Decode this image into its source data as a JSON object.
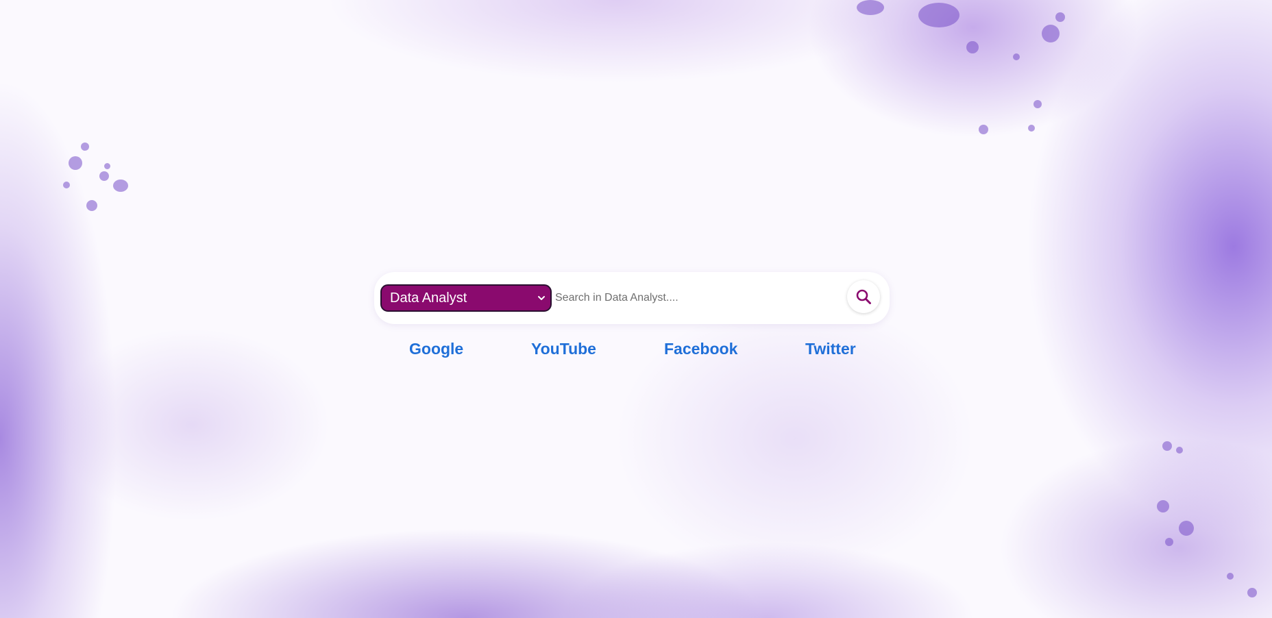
{
  "search": {
    "category_selected": "Data Analyst",
    "placeholder": "Search in Data Analyst....",
    "value": "",
    "button_icon": "search-icon",
    "accent_color": "#8a0a6e"
  },
  "quick_links": [
    {
      "label": "Google"
    },
    {
      "label": "YouTube"
    },
    {
      "label": "Facebook"
    },
    {
      "label": "Twitter"
    }
  ],
  "colors": {
    "link": "#1f6fd8",
    "background_accent": "#9b7bd9"
  }
}
